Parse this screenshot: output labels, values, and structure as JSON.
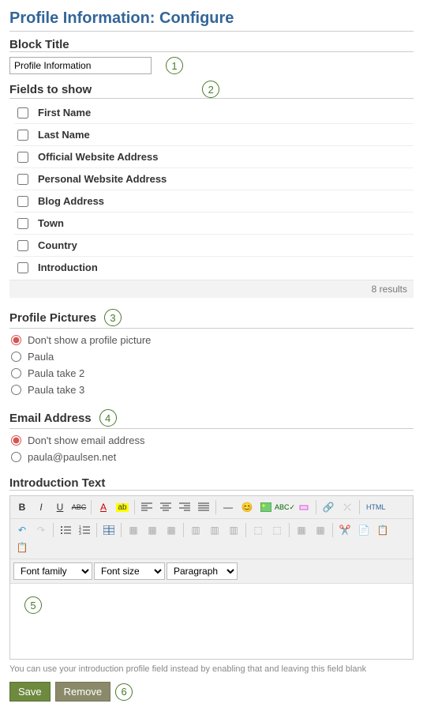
{
  "page_title": "Profile Information: Configure",
  "block_title": {
    "label": "Block Title",
    "value": "Profile Information"
  },
  "markers": {
    "m1": "1",
    "m2": "2",
    "m3": "3",
    "m4": "4",
    "m5": "5",
    "m6": "6"
  },
  "fields_section": {
    "title": "Fields to show",
    "items": [
      "First Name",
      "Last Name",
      "Official Website Address",
      "Personal Website Address",
      "Blog Address",
      "Town",
      "Country",
      "Introduction"
    ],
    "results": "8 results"
  },
  "profile_pictures": {
    "title": "Profile Pictures",
    "options": [
      "Don't show a profile picture",
      "Paula",
      "Paula take 2",
      "Paula take 3"
    ],
    "selected": 0
  },
  "email": {
    "title": "Email Address",
    "options": [
      "Don't show email address",
      "paula@paulsen.net"
    ],
    "selected": 0
  },
  "intro": {
    "title": "Introduction Text",
    "font_family_label": "Font family",
    "font_size_label": "Font size",
    "paragraph_label": "Paragraph",
    "hint": "You can use your introduction profile field instead by enabling that and leaving this field blank",
    "html_btn": "HTML"
  },
  "buttons": {
    "save": "Save",
    "remove": "Remove"
  }
}
